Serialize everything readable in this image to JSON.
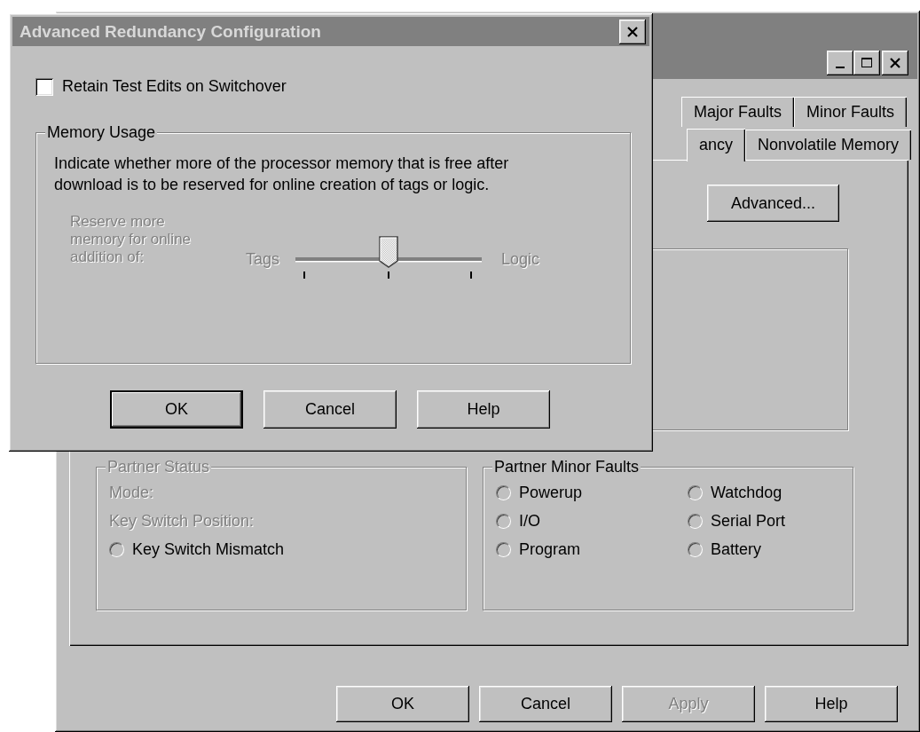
{
  "background_window": {
    "tabs_row_1": [
      {
        "label": "Major Faults",
        "selected": false
      },
      {
        "label": "Minor Faults",
        "selected": false
      }
    ],
    "tabs_row_2": [
      {
        "label": "ancy",
        "selected": true
      },
      {
        "label": "Nonvolatile Memory",
        "selected": false
      }
    ],
    "advanced_button": "Advanced...",
    "partner_status": {
      "title": "Partner Status",
      "disabled": true,
      "fields": [
        {
          "label": "Mode:",
          "disabled": true
        },
        {
          "label": "Key Switch Position:",
          "disabled": true
        }
      ],
      "indicators": [
        {
          "label": "Key Switch Mismatch",
          "on": false
        }
      ]
    },
    "partner_minor_faults": {
      "title": "Partner Minor Faults",
      "disabled": false,
      "indicators": [
        {
          "label": "Powerup",
          "on": false
        },
        {
          "label": "Watchdog",
          "on": false
        },
        {
          "label": "I/O",
          "on": false
        },
        {
          "label": "Serial Port",
          "on": false
        },
        {
          "label": "Program",
          "on": false
        },
        {
          "label": "Battery",
          "on": false
        }
      ]
    },
    "buttons": [
      {
        "label": "OK",
        "disabled": false
      },
      {
        "label": "Cancel",
        "disabled": false
      },
      {
        "label": "Apply",
        "disabled": true
      },
      {
        "label": "Help",
        "disabled": false
      }
    ]
  },
  "dialog": {
    "title": "Advanced Redundancy Configuration",
    "retain_checkbox": {
      "label": "Retain Test Edits on Switchover",
      "checked": false
    },
    "memory_usage": {
      "title": "Memory Usage",
      "description": "Indicate whether more of the processor memory that is free after download is to be reserved for online creation of tags or logic.",
      "slider": {
        "label": "Reserve more memory for online addition of:",
        "min_label": "Tags",
        "max_label": "Logic",
        "level": 0.5,
        "disabled": true
      }
    },
    "buttons": [
      {
        "label": "OK",
        "default": true
      },
      {
        "label": "Cancel",
        "default": false
      },
      {
        "label": "Help",
        "default": false
      }
    ]
  }
}
